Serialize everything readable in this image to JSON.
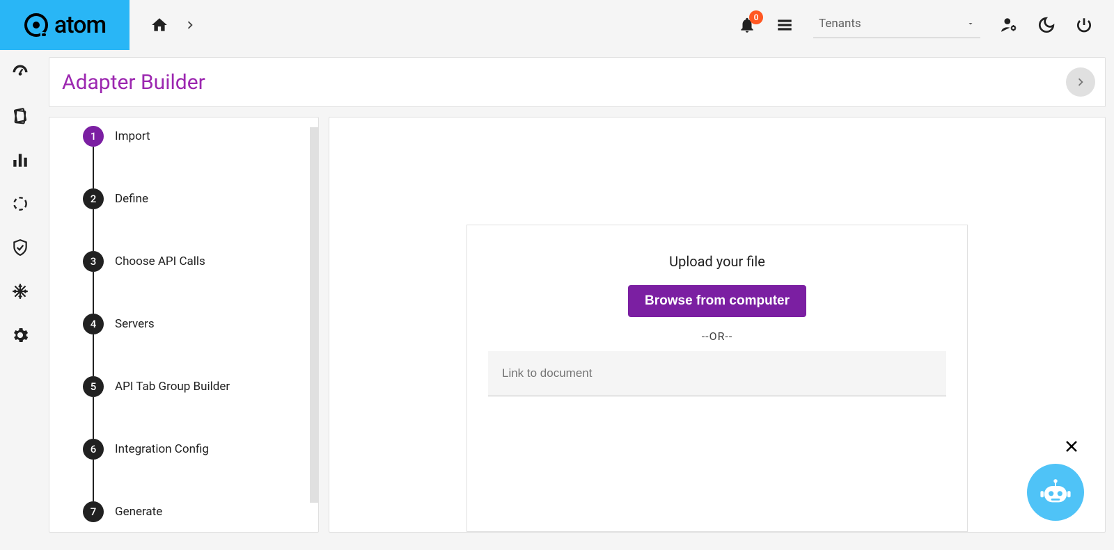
{
  "brand": {
    "name": "atom"
  },
  "header": {
    "notification_count": "0",
    "tenant_label": "Tenants"
  },
  "page": {
    "title": "Adapter Builder"
  },
  "steps": [
    {
      "num": "1",
      "label": "Import",
      "active": true
    },
    {
      "num": "2",
      "label": "Define",
      "active": false
    },
    {
      "num": "3",
      "label": "Choose API Calls",
      "active": false
    },
    {
      "num": "4",
      "label": "Servers",
      "active": false
    },
    {
      "num": "5",
      "label": "API Tab Group Builder",
      "active": false
    },
    {
      "num": "6",
      "label": "Integration Config",
      "active": false
    },
    {
      "num": "7",
      "label": "Generate",
      "active": false
    }
  ],
  "upload": {
    "title": "Upload your file",
    "button": "Browse from computer",
    "or": "--OR--",
    "placeholder": "Link to document"
  }
}
